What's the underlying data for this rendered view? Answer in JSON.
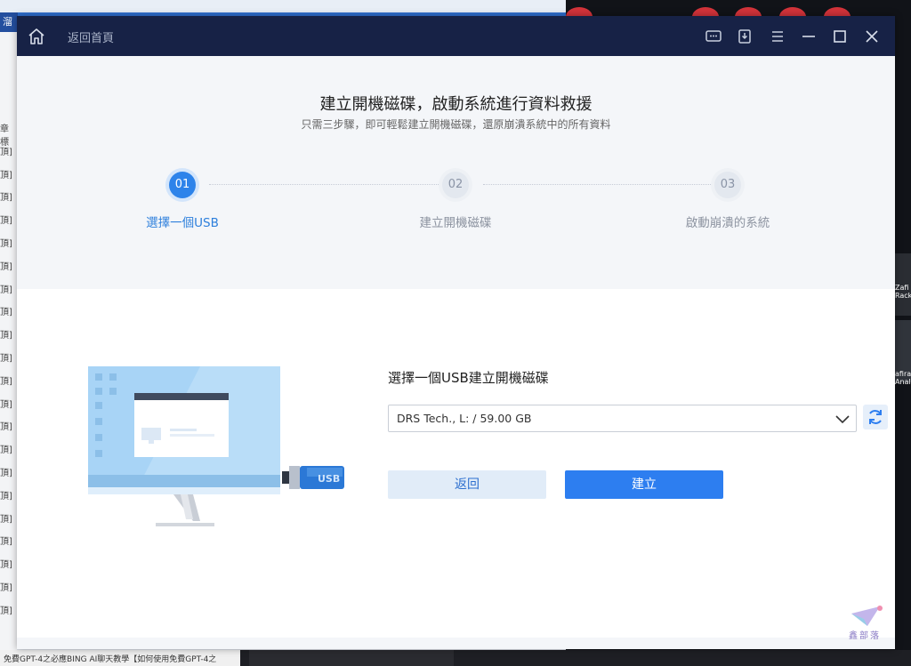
{
  "background": {
    "top_tab_text": "溜",
    "left_rows": [
      "章標",
      "頂]",
      "頂]",
      "頂]",
      "頂]",
      "頂]",
      "頂]",
      "頂]",
      "頂]",
      "頂]",
      "頂]",
      "頂]",
      "頂]",
      "頂]",
      "頂]",
      "頂]",
      "頂]",
      "頂]",
      "頂]",
      "頂]",
      "頂]",
      "頂]"
    ],
    "bottom_left_text": "免費GPT-4之必應BING AI聊天教學【如何使用免費GPT-4之",
    "right_thumb_1": "Zafi Rack",
    "right_thumb_2": "afira Anal"
  },
  "window": {
    "back_home": "返回首頁",
    "icons": [
      "home-icon",
      "feedback-icon",
      "download-icon",
      "menu-icon",
      "minimize-icon",
      "maximize-icon",
      "close-icon"
    ]
  },
  "header": {
    "title": "建立開機磁碟，啟動系統進行資料救援",
    "subtitle": "只需三步驟，即可輕鬆建立開機磁碟，還原崩潰系統中的所有資料"
  },
  "steps": [
    {
      "number": "01",
      "label": "選擇一個USB",
      "active": true
    },
    {
      "number": "02",
      "label": "建立開機磁碟",
      "active": false
    },
    {
      "number": "03",
      "label": "啟動崩潰的系統",
      "active": false
    }
  ],
  "form": {
    "select_title": "選擇一個USB建立開機磁碟",
    "selected_drive": "DRS Tech., L: / 59.00 GB",
    "back_label": "返回",
    "create_label": "建立"
  },
  "illustration": {
    "usb_text": "USB"
  },
  "watermark": {
    "text": "鑫部落"
  },
  "colors": {
    "titlebar": "#172246",
    "accent": "#2d7ef0",
    "header_bg": "#f4f6f9"
  }
}
